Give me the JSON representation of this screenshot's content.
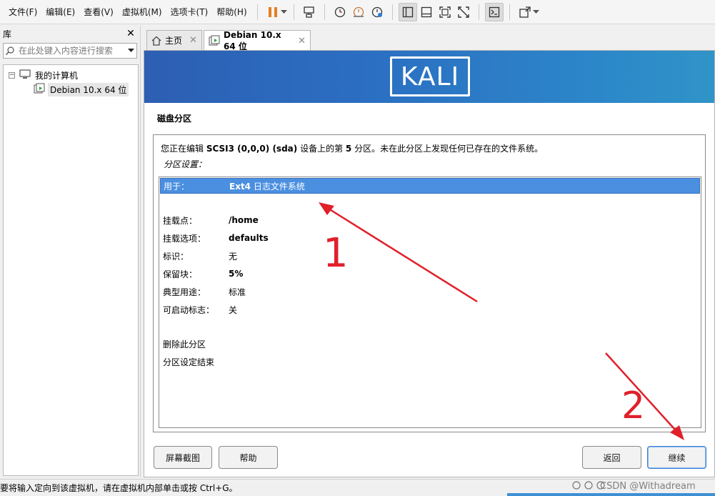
{
  "menubar": {
    "items": [
      "文件(F)",
      "编辑(E)",
      "查看(V)",
      "虚拟机(M)",
      "选项卡(T)",
      "帮助(H)"
    ]
  },
  "toolbar": {
    "icons": [
      "pause-icon",
      "send-ctrl-alt-del-icon",
      "snapshot-icon",
      "snapshot-restore-icon",
      "snapshot-manager-icon",
      "library-view-icon",
      "thumbnail-view-icon",
      "fullscreen-icon",
      "unity-icon",
      "console-icon",
      "stretch-icon"
    ],
    "accent": "#e67e22"
  },
  "library": {
    "title": "库",
    "search_placeholder": "在此处键入内容进行搜索",
    "tree": {
      "root": "我的计算机",
      "child": "Debian 10.x 64 位"
    }
  },
  "tabs": [
    {
      "label": "主页",
      "icon": "home-icon"
    },
    {
      "label": "Debian 10.x 64 位",
      "icon": "vm-icon"
    }
  ],
  "installer": {
    "logo_text": "KALI",
    "page_title": "磁盘分区",
    "desc_prefix": "您正在编辑 ",
    "desc_device": "SCSI3 (0,0,0) (sda)",
    "desc_mid": " 设备上的第 ",
    "desc_num": "5",
    "desc_suffix": " 分区。未在此分区上发现任何已存在的文件系统。",
    "settings_label": "分区设置：",
    "options": [
      {
        "key": "用于：",
        "val_bold": "Ext4",
        "val_rest": " 日志文件系统"
      },
      {
        "key": "挂载点：",
        "val": "/home"
      },
      {
        "key": "挂载选项：",
        "val": "defaults"
      },
      {
        "key": "标识：",
        "val": "无"
      },
      {
        "key": "保留块：",
        "val": "5%"
      },
      {
        "key": "典型用途：",
        "val": "标准"
      },
      {
        "key": "可启动标志：",
        "val": "关"
      },
      {
        "key": "删除此分区"
      },
      {
        "key": "分区设定结束"
      }
    ],
    "buttons": {
      "screenshot": "屏幕截图",
      "help": "帮助",
      "back": "返回",
      "continue": "继续"
    },
    "banner_color": "#2b6fc2",
    "selected_color": "#4a8fe0"
  },
  "annotations": {
    "label_1": "1",
    "label_2": "2",
    "color": "#e0202a"
  },
  "status": {
    "text": "要将输入定向到该虚拟机，请在虚拟机内部单击或按 Ctrl+G。",
    "watermark": "CSDN @Withadream"
  }
}
